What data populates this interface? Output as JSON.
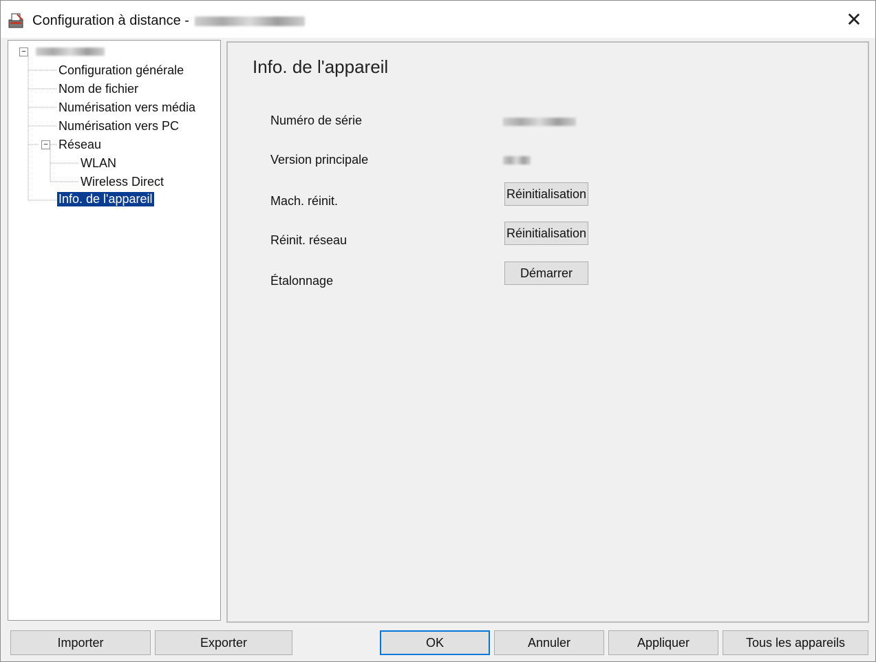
{
  "window": {
    "title": "Configuration à distance -",
    "close_glyph": "✕",
    "app_icon": "printer-config-icon"
  },
  "tree": {
    "items": [
      {
        "label": "Configuration générale"
      },
      {
        "label": "Nom de fichier"
      },
      {
        "label": "Numérisation vers média"
      },
      {
        "label": "Numérisation vers PC"
      },
      {
        "label": "Réseau",
        "expander": "−"
      },
      {
        "label": "WLAN"
      },
      {
        "label": "Wireless Direct"
      },
      {
        "label": "Info. de l'appareil",
        "selected": true
      }
    ],
    "root_expander": "−"
  },
  "panel": {
    "title": "Info. de l'appareil",
    "rows": [
      {
        "label": "Numéro de série"
      },
      {
        "label": "Version principale"
      },
      {
        "label": "Mach. réinit.",
        "button": "Réinitialisation"
      },
      {
        "label": "Réinit. réseau",
        "button": "Réinitialisation"
      },
      {
        "label": "Étalonnage",
        "button": "Démarrer"
      }
    ]
  },
  "footer": {
    "import": "Importer",
    "export": "Exporter",
    "ok": "OK",
    "cancel": "Annuler",
    "apply": "Appliquer",
    "all_devices": "Tous les appareils"
  },
  "colors": {
    "selection": "#0a3d91",
    "default_button_border": "#0078d7"
  }
}
